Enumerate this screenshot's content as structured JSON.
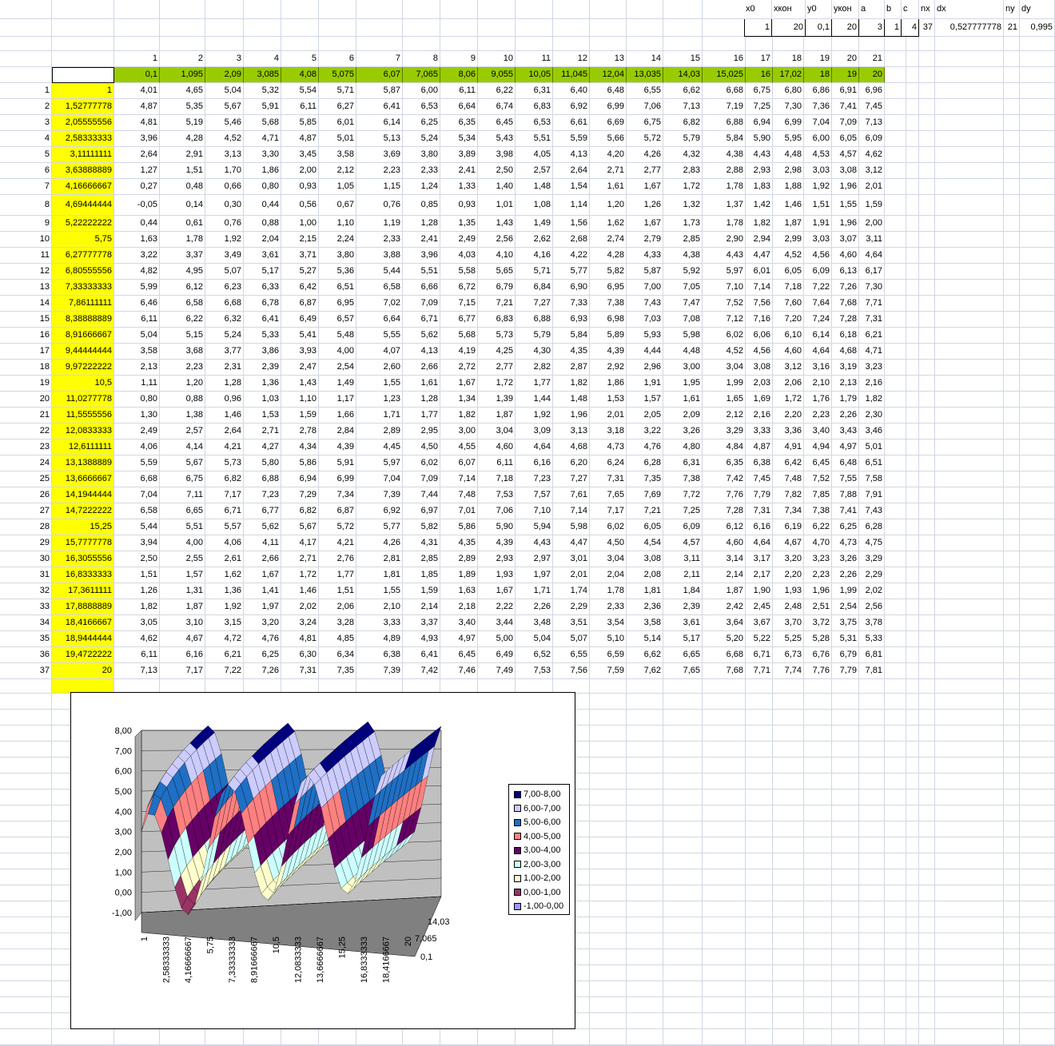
{
  "params": {
    "headers": [
      "x0",
      "xкон",
      "y0",
      "yкон",
      "a",
      "b",
      "c",
      "nx",
      "dx",
      "",
      "ny",
      "dy"
    ],
    "values": [
      "1",
      "20",
      "0,1",
      "20",
      "3",
      "1",
      "4",
      "37",
      "0,527777778",
      "",
      "21",
      "0,995"
    ]
  },
  "col_numbers": [
    "1",
    "2",
    "3",
    "4",
    "5",
    "6",
    "7",
    "8",
    "9",
    "10",
    "11",
    "12",
    "13",
    "14",
    "15",
    "16",
    "17",
    "18",
    "19",
    "20",
    "21"
  ],
  "y_values": [
    "0,1",
    "1,095",
    "2,09",
    "3,085",
    "4,08",
    "5,075",
    "6,07",
    "7,065",
    "8,06",
    "9,055",
    "10,05",
    "11,045",
    "12,04",
    "13,035",
    "14,03",
    "15,025",
    "16",
    "17,02",
    "18",
    "19",
    "20"
  ],
  "row_numbers": [
    "1",
    "2",
    "3",
    "4",
    "5",
    "6",
    "7",
    "8",
    "9",
    "10",
    "11",
    "12",
    "13",
    "14",
    "15",
    "16",
    "17",
    "18",
    "19",
    "20",
    "21",
    "22",
    "23",
    "24",
    "25",
    "26",
    "27",
    "28",
    "29",
    "30",
    "31",
    "32",
    "33",
    "34",
    "35",
    "36",
    "37"
  ],
  "x_values": [
    "1",
    "1,52777778",
    "2,05555556",
    "2,58333333",
    "3,11111111",
    "3,63888889",
    "4,16666667",
    "4,69444444",
    "5,22222222",
    "5,75",
    "6,27777778",
    "6,80555556",
    "7,33333333",
    "7,86111111",
    "8,38888889",
    "8,91666667",
    "9,44444444",
    "9,97222222",
    "10,5",
    "11,0277778",
    "11,5555556",
    "12,0833333",
    "12,6111111",
    "13,1388889",
    "13,6666667",
    "14,1944444",
    "14,7222222",
    "15,25",
    "15,7777778",
    "16,3055556",
    "16,8333333",
    "17,3611111",
    "17,8888889",
    "18,4166667",
    "18,9444444",
    "19,4722222",
    "20"
  ],
  "table": [
    [
      "4,01",
      "4,65",
      "5,04",
      "5,32",
      "5,54",
      "5,71",
      "5,87",
      "6,00",
      "6,11",
      "6,22",
      "6,31",
      "6,40",
      "6,48",
      "6,55",
      "6,62",
      "6,68",
      "6,75",
      "6,80",
      "6,86",
      "6,91",
      "6,96"
    ],
    [
      "4,87",
      "5,35",
      "5,67",
      "5,91",
      "6,11",
      "6,27",
      "6,41",
      "6,53",
      "6,64",
      "6,74",
      "6,83",
      "6,92",
      "6,99",
      "7,06",
      "7,13",
      "7,19",
      "7,25",
      "7,30",
      "7,36",
      "7,41",
      "7,45"
    ],
    [
      "4,81",
      "5,19",
      "5,46",
      "5,68",
      "5,85",
      "6,01",
      "6,14",
      "6,25",
      "6,35",
      "6,45",
      "6,53",
      "6,61",
      "6,69",
      "6,75",
      "6,82",
      "6,88",
      "6,94",
      "6,99",
      "7,04",
      "7,09",
      "7,13"
    ],
    [
      "3,96",
      "4,28",
      "4,52",
      "4,71",
      "4,87",
      "5,01",
      "5,13",
      "5,24",
      "5,34",
      "5,43",
      "5,51",
      "5,59",
      "5,66",
      "5,72",
      "5,79",
      "5,84",
      "5,90",
      "5,95",
      "6,00",
      "6,05",
      "6,09"
    ],
    [
      "2,64",
      "2,91",
      "3,13",
      "3,30",
      "3,45",
      "3,58",
      "3,69",
      "3,80",
      "3,89",
      "3,98",
      "4,05",
      "4,13",
      "4,20",
      "4,26",
      "4,32",
      "4,38",
      "4,43",
      "4,48",
      "4,53",
      "4,57",
      "4,62"
    ],
    [
      "1,27",
      "1,51",
      "1,70",
      "1,86",
      "2,00",
      "2,12",
      "2,23",
      "2,33",
      "2,41",
      "2,50",
      "2,57",
      "2,64",
      "2,71",
      "2,77",
      "2,83",
      "2,88",
      "2,93",
      "2,98",
      "3,03",
      "3,08",
      "3,12"
    ],
    [
      "0,27",
      "0,48",
      "0,66",
      "0,80",
      "0,93",
      "1,05",
      "1,15",
      "1,24",
      "1,33",
      "1,40",
      "1,48",
      "1,54",
      "1,61",
      "1,67",
      "1,72",
      "1,78",
      "1,83",
      "1,88",
      "1,92",
      "1,96",
      "2,01"
    ],
    [
      "-0,05",
      "0,14",
      "0,30",
      "0,44",
      "0,56",
      "0,67",
      "0,76",
      "0,85",
      "0,93",
      "1,01",
      "1,08",
      "1,14",
      "1,20",
      "1,26",
      "1,32",
      "1,37",
      "1,42",
      "1,46",
      "1,51",
      "1,55",
      "1,59"
    ],
    [
      "0,44",
      "0,61",
      "0,76",
      "0,88",
      "1,00",
      "1,10",
      "1,19",
      "1,28",
      "1,35",
      "1,43",
      "1,49",
      "1,56",
      "1,62",
      "1,67",
      "1,73",
      "1,78",
      "1,82",
      "1,87",
      "1,91",
      "1,96",
      "2,00"
    ],
    [
      "1,63",
      "1,78",
      "1,92",
      "2,04",
      "2,15",
      "2,24",
      "2,33",
      "2,41",
      "2,49",
      "2,56",
      "2,62",
      "2,68",
      "2,74",
      "2,79",
      "2,85",
      "2,90",
      "2,94",
      "2,99",
      "3,03",
      "3,07",
      "3,11"
    ],
    [
      "3,22",
      "3,37",
      "3,49",
      "3,61",
      "3,71",
      "3,80",
      "3,88",
      "3,96",
      "4,03",
      "4,10",
      "4,16",
      "4,22",
      "4,28",
      "4,33",
      "4,38",
      "4,43",
      "4,47",
      "4,52",
      "4,56",
      "4,60",
      "4,64"
    ],
    [
      "4,82",
      "4,95",
      "5,07",
      "5,17",
      "5,27",
      "5,36",
      "5,44",
      "5,51",
      "5,58",
      "5,65",
      "5,71",
      "5,77",
      "5,82",
      "5,87",
      "5,92",
      "5,97",
      "6,01",
      "6,05",
      "6,09",
      "6,13",
      "6,17"
    ],
    [
      "5,99",
      "6,12",
      "6,23",
      "6,33",
      "6,42",
      "6,51",
      "6,58",
      "6,66",
      "6,72",
      "6,79",
      "6,84",
      "6,90",
      "6,95",
      "7,00",
      "7,05",
      "7,10",
      "7,14",
      "7,18",
      "7,22",
      "7,26",
      "7,30"
    ],
    [
      "6,46",
      "6,58",
      "6,68",
      "6,78",
      "6,87",
      "6,95",
      "7,02",
      "7,09",
      "7,15",
      "7,21",
      "7,27",
      "7,33",
      "7,38",
      "7,43",
      "7,47",
      "7,52",
      "7,56",
      "7,60",
      "7,64",
      "7,68",
      "7,71"
    ],
    [
      "6,11",
      "6,22",
      "6,32",
      "6,41",
      "6,49",
      "6,57",
      "6,64",
      "6,71",
      "6,77",
      "6,83",
      "6,88",
      "6,93",
      "6,98",
      "7,03",
      "7,08",
      "7,12",
      "7,16",
      "7,20",
      "7,24",
      "7,28",
      "7,31"
    ],
    [
      "5,04",
      "5,15",
      "5,24",
      "5,33",
      "5,41",
      "5,48",
      "5,55",
      "5,62",
      "5,68",
      "5,73",
      "5,79",
      "5,84",
      "5,89",
      "5,93",
      "5,98",
      "6,02",
      "6,06",
      "6,10",
      "6,14",
      "6,18",
      "6,21"
    ],
    [
      "3,58",
      "3,68",
      "3,77",
      "3,86",
      "3,93",
      "4,00",
      "4,07",
      "4,13",
      "4,19",
      "4,25",
      "4,30",
      "4,35",
      "4,39",
      "4,44",
      "4,48",
      "4,52",
      "4,56",
      "4,60",
      "4,64",
      "4,68",
      "4,71"
    ],
    [
      "2,13",
      "2,23",
      "2,31",
      "2,39",
      "2,47",
      "2,54",
      "2,60",
      "2,66",
      "2,72",
      "2,77",
      "2,82",
      "2,87",
      "2,92",
      "2,96",
      "3,00",
      "3,04",
      "3,08",
      "3,12",
      "3,16",
      "3,19",
      "3,23"
    ],
    [
      "1,11",
      "1,20",
      "1,28",
      "1,36",
      "1,43",
      "1,49",
      "1,55",
      "1,61",
      "1,67",
      "1,72",
      "1,77",
      "1,82",
      "1,86",
      "1,91",
      "1,95",
      "1,99",
      "2,03",
      "2,06",
      "2,10",
      "2,13",
      "2,16"
    ],
    [
      "0,80",
      "0,88",
      "0,96",
      "1,03",
      "1,10",
      "1,17",
      "1,23",
      "1,28",
      "1,34",
      "1,39",
      "1,44",
      "1,48",
      "1,53",
      "1,57",
      "1,61",
      "1,65",
      "1,69",
      "1,72",
      "1,76",
      "1,79",
      "1,82"
    ],
    [
      "1,30",
      "1,38",
      "1,46",
      "1,53",
      "1,59",
      "1,66",
      "1,71",
      "1,77",
      "1,82",
      "1,87",
      "1,92",
      "1,96",
      "2,01",
      "2,05",
      "2,09",
      "2,12",
      "2,16",
      "2,20",
      "2,23",
      "2,26",
      "2,30"
    ],
    [
      "2,49",
      "2,57",
      "2,64",
      "2,71",
      "2,78",
      "2,84",
      "2,89",
      "2,95",
      "3,00",
      "3,04",
      "3,09",
      "3,13",
      "3,18",
      "3,22",
      "3,26",
      "3,29",
      "3,33",
      "3,36",
      "3,40",
      "3,43",
      "3,46"
    ],
    [
      "4,06",
      "4,14",
      "4,21",
      "4,27",
      "4,34",
      "4,39",
      "4,45",
      "4,50",
      "4,55",
      "4,60",
      "4,64",
      "4,68",
      "4,73",
      "4,76",
      "4,80",
      "4,84",
      "4,87",
      "4,91",
      "4,94",
      "4,97",
      "5,01"
    ],
    [
      "5,59",
      "5,67",
      "5,73",
      "5,80",
      "5,86",
      "5,91",
      "5,97",
      "6,02",
      "6,07",
      "6,11",
      "6,16",
      "6,20",
      "6,24",
      "6,28",
      "6,31",
      "6,35",
      "6,38",
      "6,42",
      "6,45",
      "6,48",
      "6,51"
    ],
    [
      "6,68",
      "6,75",
      "6,82",
      "6,88",
      "6,94",
      "6,99",
      "7,04",
      "7,09",
      "7,14",
      "7,18",
      "7,23",
      "7,27",
      "7,31",
      "7,35",
      "7,38",
      "7,42",
      "7,45",
      "7,48",
      "7,52",
      "7,55",
      "7,58"
    ],
    [
      "7,04",
      "7,11",
      "7,17",
      "7,23",
      "7,29",
      "7,34",
      "7,39",
      "7,44",
      "7,48",
      "7,53",
      "7,57",
      "7,61",
      "7,65",
      "7,69",
      "7,72",
      "7,76",
      "7,79",
      "7,82",
      "7,85",
      "7,88",
      "7,91"
    ],
    [
      "6,58",
      "6,65",
      "6,71",
      "6,77",
      "6,82",
      "6,87",
      "6,92",
      "6,97",
      "7,01",
      "7,06",
      "7,10",
      "7,14",
      "7,17",
      "7,21",
      "7,25",
      "7,28",
      "7,31",
      "7,34",
      "7,38",
      "7,41",
      "7,43"
    ],
    [
      "5,44",
      "5,51",
      "5,57",
      "5,62",
      "5,67",
      "5,72",
      "5,77",
      "5,82",
      "5,86",
      "5,90",
      "5,94",
      "5,98",
      "6,02",
      "6,05",
      "6,09",
      "6,12",
      "6,16",
      "6,19",
      "6,22",
      "6,25",
      "6,28"
    ],
    [
      "3,94",
      "4,00",
      "4,06",
      "4,11",
      "4,17",
      "4,21",
      "4,26",
      "4,31",
      "4,35",
      "4,39",
      "4,43",
      "4,47",
      "4,50",
      "4,54",
      "4,57",
      "4,60",
      "4,64",
      "4,67",
      "4,70",
      "4,73",
      "4,75"
    ],
    [
      "2,50",
      "2,55",
      "2,61",
      "2,66",
      "2,71",
      "2,76",
      "2,81",
      "2,85",
      "2,89",
      "2,93",
      "2,97",
      "3,01",
      "3,04",
      "3,08",
      "3,11",
      "3,14",
      "3,17",
      "3,20",
      "3,23",
      "3,26",
      "3,29"
    ],
    [
      "1,51",
      "1,57",
      "1,62",
      "1,67",
      "1,72",
      "1,77",
      "1,81",
      "1,85",
      "1,89",
      "1,93",
      "1,97",
      "2,01",
      "2,04",
      "2,08",
      "2,11",
      "2,14",
      "2,17",
      "2,20",
      "2,23",
      "2,26",
      "2,29"
    ],
    [
      "1,26",
      "1,31",
      "1,36",
      "1,41",
      "1,46",
      "1,51",
      "1,55",
      "1,59",
      "1,63",
      "1,67",
      "1,71",
      "1,74",
      "1,78",
      "1,81",
      "1,84",
      "1,87",
      "1,90",
      "1,93",
      "1,96",
      "1,99",
      "2,02"
    ],
    [
      "1,82",
      "1,87",
      "1,92",
      "1,97",
      "2,02",
      "2,06",
      "2,10",
      "2,14",
      "2,18",
      "2,22",
      "2,26",
      "2,29",
      "2,33",
      "2,36",
      "2,39",
      "2,42",
      "2,45",
      "2,48",
      "2,51",
      "2,54",
      "2,56"
    ],
    [
      "3,05",
      "3,10",
      "3,15",
      "3,20",
      "3,24",
      "3,28",
      "3,33",
      "3,37",
      "3,40",
      "3,44",
      "3,48",
      "3,51",
      "3,54",
      "3,58",
      "3,61",
      "3,64",
      "3,67",
      "3,70",
      "3,72",
      "3,75",
      "3,78"
    ],
    [
      "4,62",
      "4,67",
      "4,72",
      "4,76",
      "4,81",
      "4,85",
      "4,89",
      "4,93",
      "4,97",
      "5,00",
      "5,04",
      "5,07",
      "5,10",
      "5,14",
      "5,17",
      "5,20",
      "5,22",
      "5,25",
      "5,28",
      "5,31",
      "5,33"
    ],
    [
      "6,11",
      "6,16",
      "6,21",
      "6,25",
      "6,30",
      "6,34",
      "6,38",
      "6,41",
      "6,45",
      "6,49",
      "6,52",
      "6,55",
      "6,59",
      "6,62",
      "6,65",
      "6,68",
      "6,71",
      "6,73",
      "6,76",
      "6,79",
      "6,81"
    ],
    [
      "7,13",
      "7,17",
      "7,22",
      "7,26",
      "7,31",
      "7,35",
      "7,39",
      "7,42",
      "7,46",
      "7,49",
      "7,53",
      "7,56",
      "7,59",
      "7,62",
      "7,65",
      "7,68",
      "7,71",
      "7,74",
      "7,76",
      "7,79",
      "7,81"
    ]
  ],
  "chart_data": {
    "type": "surface",
    "z_ticks": [
      "8,00",
      "7,00",
      "6,00",
      "5,00",
      "4,00",
      "3,00",
      "2,00",
      "1,00",
      "0,00",
      "-1,00"
    ],
    "z_range": [
      -1,
      8
    ],
    "x_tick_labels": [
      "1",
      "2,58333333",
      "4,16666667",
      "5,75",
      "7,33333333",
      "8,91666667",
      "10,5",
      "12,0833333",
      "13,6666667",
      "15,25",
      "16,8333333",
      "18,4166667",
      "20"
    ],
    "y_tick_labels": [
      "14,03",
      "7,065",
      "0,1"
    ],
    "legend_position": "right",
    "legend": [
      {
        "label": "7,00-8,00",
        "color": "#000080"
      },
      {
        "label": "6,00-7,00",
        "color": "#ccccff"
      },
      {
        "label": "5,00-6,00",
        "color": "#1f6fc4"
      },
      {
        "label": "4,00-5,00",
        "color": "#ff8080"
      },
      {
        "label": "3,00-4,00",
        "color": "#660066"
      },
      {
        "label": "2,00-3,00",
        "color": "#ccffff"
      },
      {
        "label": "1,00-2,00",
        "color": "#ffffcc"
      },
      {
        "label": "0,00-1,00",
        "color": "#993366"
      },
      {
        "label": "-1,00-0,00",
        "color": "#9999ff"
      }
    ]
  }
}
